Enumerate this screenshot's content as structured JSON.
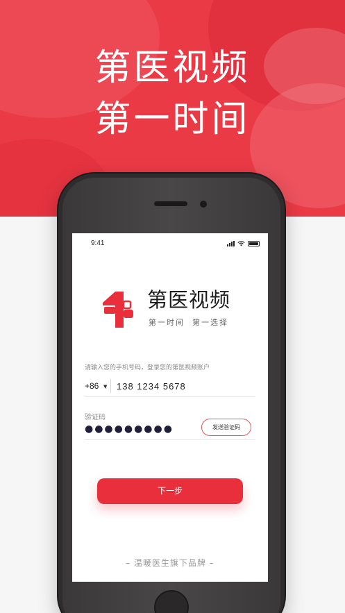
{
  "banner": {
    "headline_line1": "第医视频",
    "headline_line2": "第一时间"
  },
  "status_bar": {
    "time": "9:41"
  },
  "logo": {
    "title": "第医视频",
    "slogan": "第一时间  第一选择"
  },
  "login": {
    "prompt": "请输入您的手机号码，登录您的第医视频账户",
    "country_code": "+86",
    "phone_value": "138 1234 5678",
    "code_label": "验证码",
    "code_masked": "●●●●●●●●●",
    "send_code_label": "发送验证码",
    "next_label": "下一步"
  },
  "footer": {
    "brand_line": "– 温暖医生旗下品牌 –"
  },
  "colors": {
    "brand_red": "#ea3a46",
    "button_red": "#ea2f3c"
  }
}
